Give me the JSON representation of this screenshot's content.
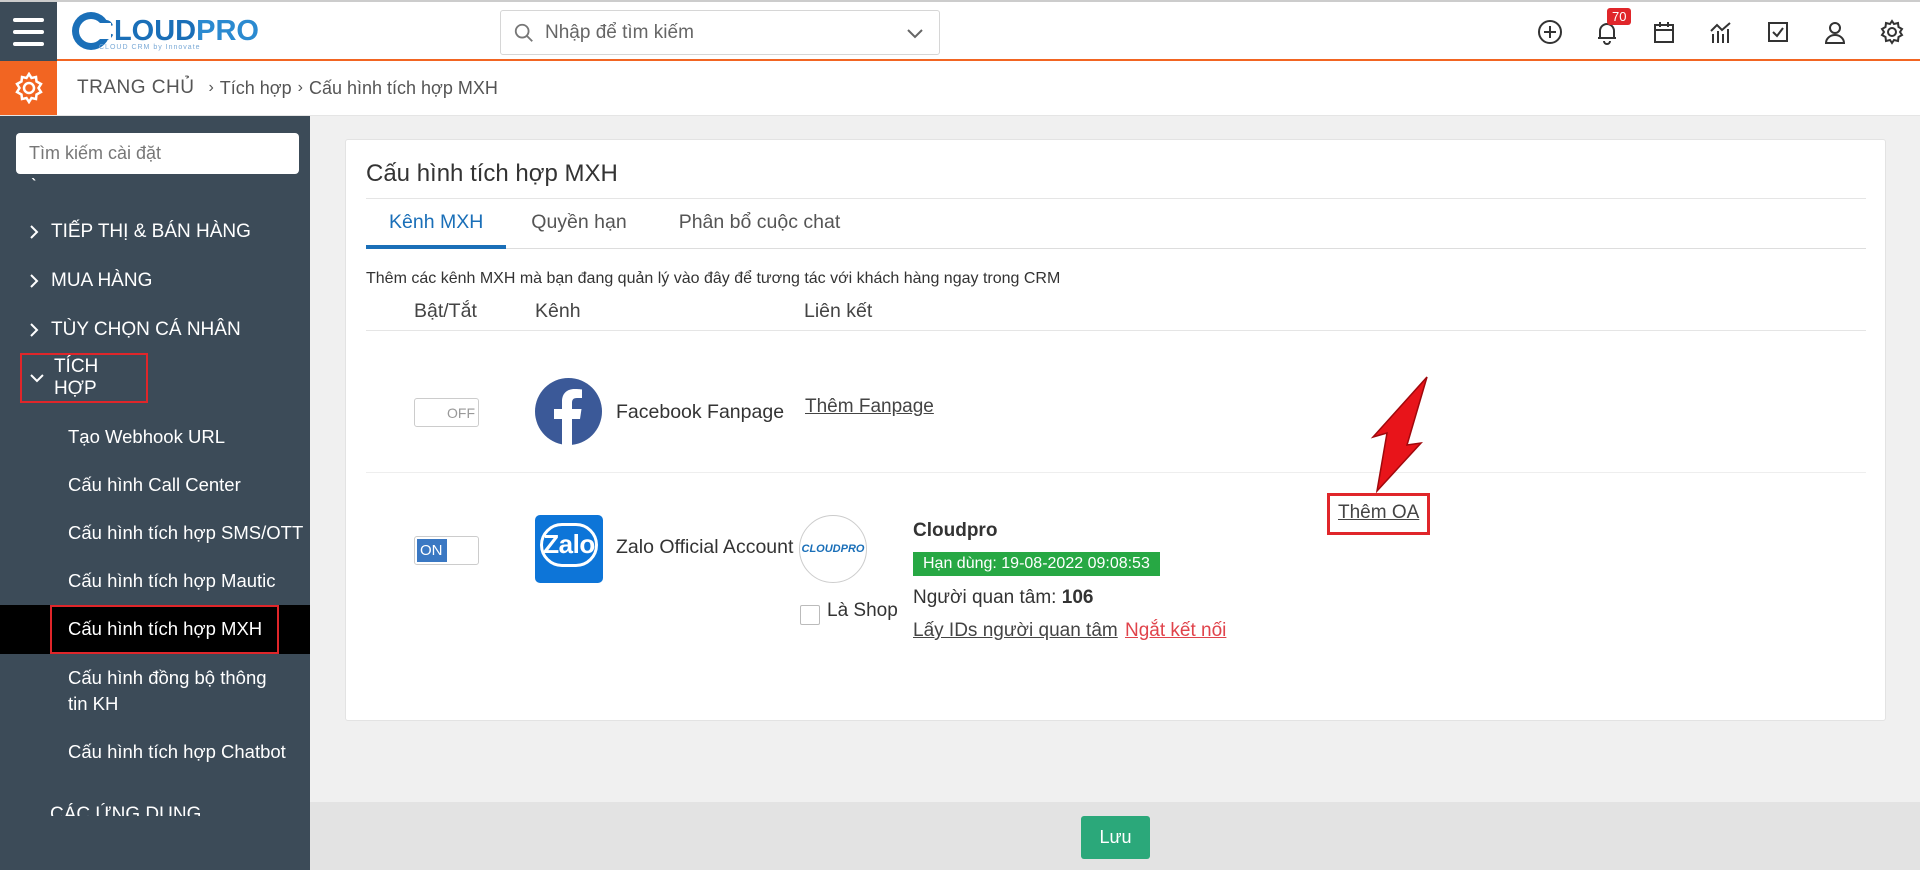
{
  "header": {
    "logo_text_a": "CLOUD",
    "logo_text_b": "PRO",
    "logo_sub": "CLOUD CRM by Innovate",
    "search_placeholder": "Nhập để tìm kiếm",
    "notification_count": "70",
    "icons": [
      "plus-circle-icon",
      "bell-icon",
      "calendar-icon",
      "report-chart-icon",
      "task-check-icon",
      "user-icon",
      "settings-gear-icon"
    ]
  },
  "breadcrumb": {
    "home": "TRANG CHỦ",
    "level1": "Tích hợp",
    "level2": "Cấu hình tích hợp MXH"
  },
  "sidebar": {
    "search_placeholder": "Tìm kiếm cài đặt",
    "groups": [
      {
        "label": "TIẾP THỊ & BÁN HÀNG"
      },
      {
        "label": "MUA HÀNG"
      },
      {
        "label": "TÙY CHỌN CÁ NHÂN"
      },
      {
        "label": "TÍCH HỢP"
      }
    ],
    "items": [
      {
        "label": "Tạo Webhook URL"
      },
      {
        "label": "Cấu hình Call Center"
      },
      {
        "label": "Cấu hình tích hợp SMS/OTT"
      },
      {
        "label": "Cấu hình tích hợp Mautic"
      },
      {
        "label": "Cấu hình tích hợp MXH"
      },
      {
        "label": "Cấu hình đồng bộ thông tin KH"
      },
      {
        "label": "Cấu hình tích hợp Chatbot"
      }
    ],
    "bottom_group": "CÁC ỨNG DỤNG"
  },
  "panel": {
    "title": "Cấu hình tích hợp MXH",
    "tabs": [
      {
        "label": "Kênh MXH"
      },
      {
        "label": "Quyền hạn"
      },
      {
        "label": "Phân bổ cuộc chat"
      }
    ],
    "description": "Thêm các kênh MXH mà bạn đang quản lý vào đây để tương tác với khách hàng ngay trong CRM",
    "columns": [
      "Bật/Tắt",
      "Kênh",
      "Liên kết"
    ],
    "rows": [
      {
        "toggle": "OFF",
        "channel": "Facebook Fanpage",
        "link": "Thêm Fanpage"
      },
      {
        "toggle": "ON",
        "channel": "Zalo Official Account",
        "logo_text": "Zalo",
        "avatar_text": "CLOUDPRO",
        "oa_name": "Cloudpro",
        "expiry": "Hạn dùng: 19-08-2022 09:08:53",
        "followers_label": "Người quan tâm:",
        "followers_count": "106",
        "shop_label": "Là Shop",
        "get_ids_link": "Lấy IDs người quan tâm",
        "disconnect_link": "Ngắt kết nối",
        "add_oa_link": "Thêm OA"
      }
    ]
  },
  "footer": {
    "save_label": "Lưu"
  },
  "colors": {
    "sidebar_bg": "#3c4b58",
    "accent_orange": "#f26522",
    "primary_blue": "#1a6fb8",
    "highlight_red": "#e0262a",
    "save_green": "#2ba87a",
    "expiry_green": "#27a844"
  }
}
